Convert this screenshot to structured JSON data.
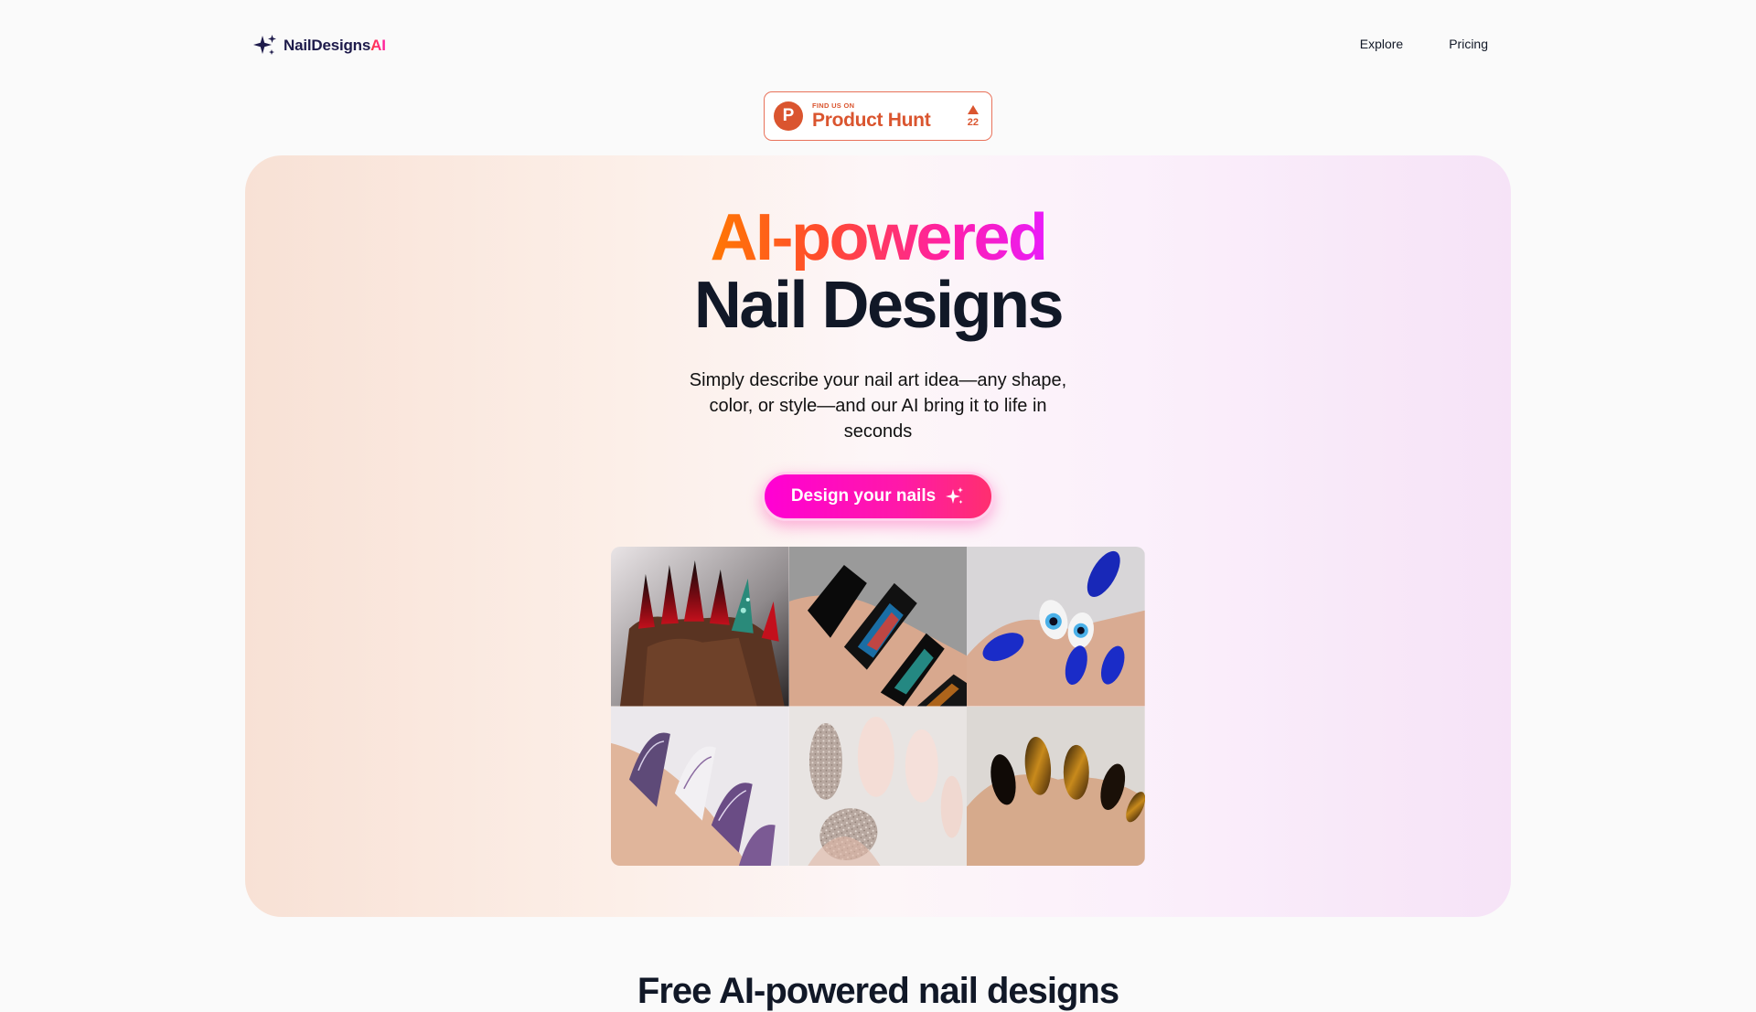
{
  "header": {
    "logo_text": "NailDesigns",
    "logo_suffix": "AI",
    "logo_icon": "sparkles-icon",
    "nav": [
      {
        "label": "Explore"
      },
      {
        "label": "Pricing"
      }
    ]
  },
  "product_hunt": {
    "small_label": "FIND US ON",
    "name": "Product Hunt",
    "letter": "P",
    "votes": "22",
    "color": "#da552f"
  },
  "hero": {
    "title_line1": "AI-powered",
    "title_line2": "Nail Designs",
    "subtitle": "Simply describe your nail art idea—any shape, color, or style—and our AI bring it to life in seconds",
    "cta_label": "Design your nails",
    "cta_icon": "sparkles-icon",
    "accent_gradient": [
      "#ff7a00",
      "#ff1fa8",
      "#e81cff"
    ]
  },
  "gallery": {
    "tiles": [
      {
        "name": "red-black-stiletto-nails"
      },
      {
        "name": "black-iridescent-coffin-nails"
      },
      {
        "name": "blue-evil-eye-nails"
      },
      {
        "name": "purple-marble-nails"
      },
      {
        "name": "pink-glitter-almond-nails"
      },
      {
        "name": "black-gold-chrome-nails"
      }
    ]
  },
  "section": {
    "title": "Free AI-powered nail designs"
  }
}
